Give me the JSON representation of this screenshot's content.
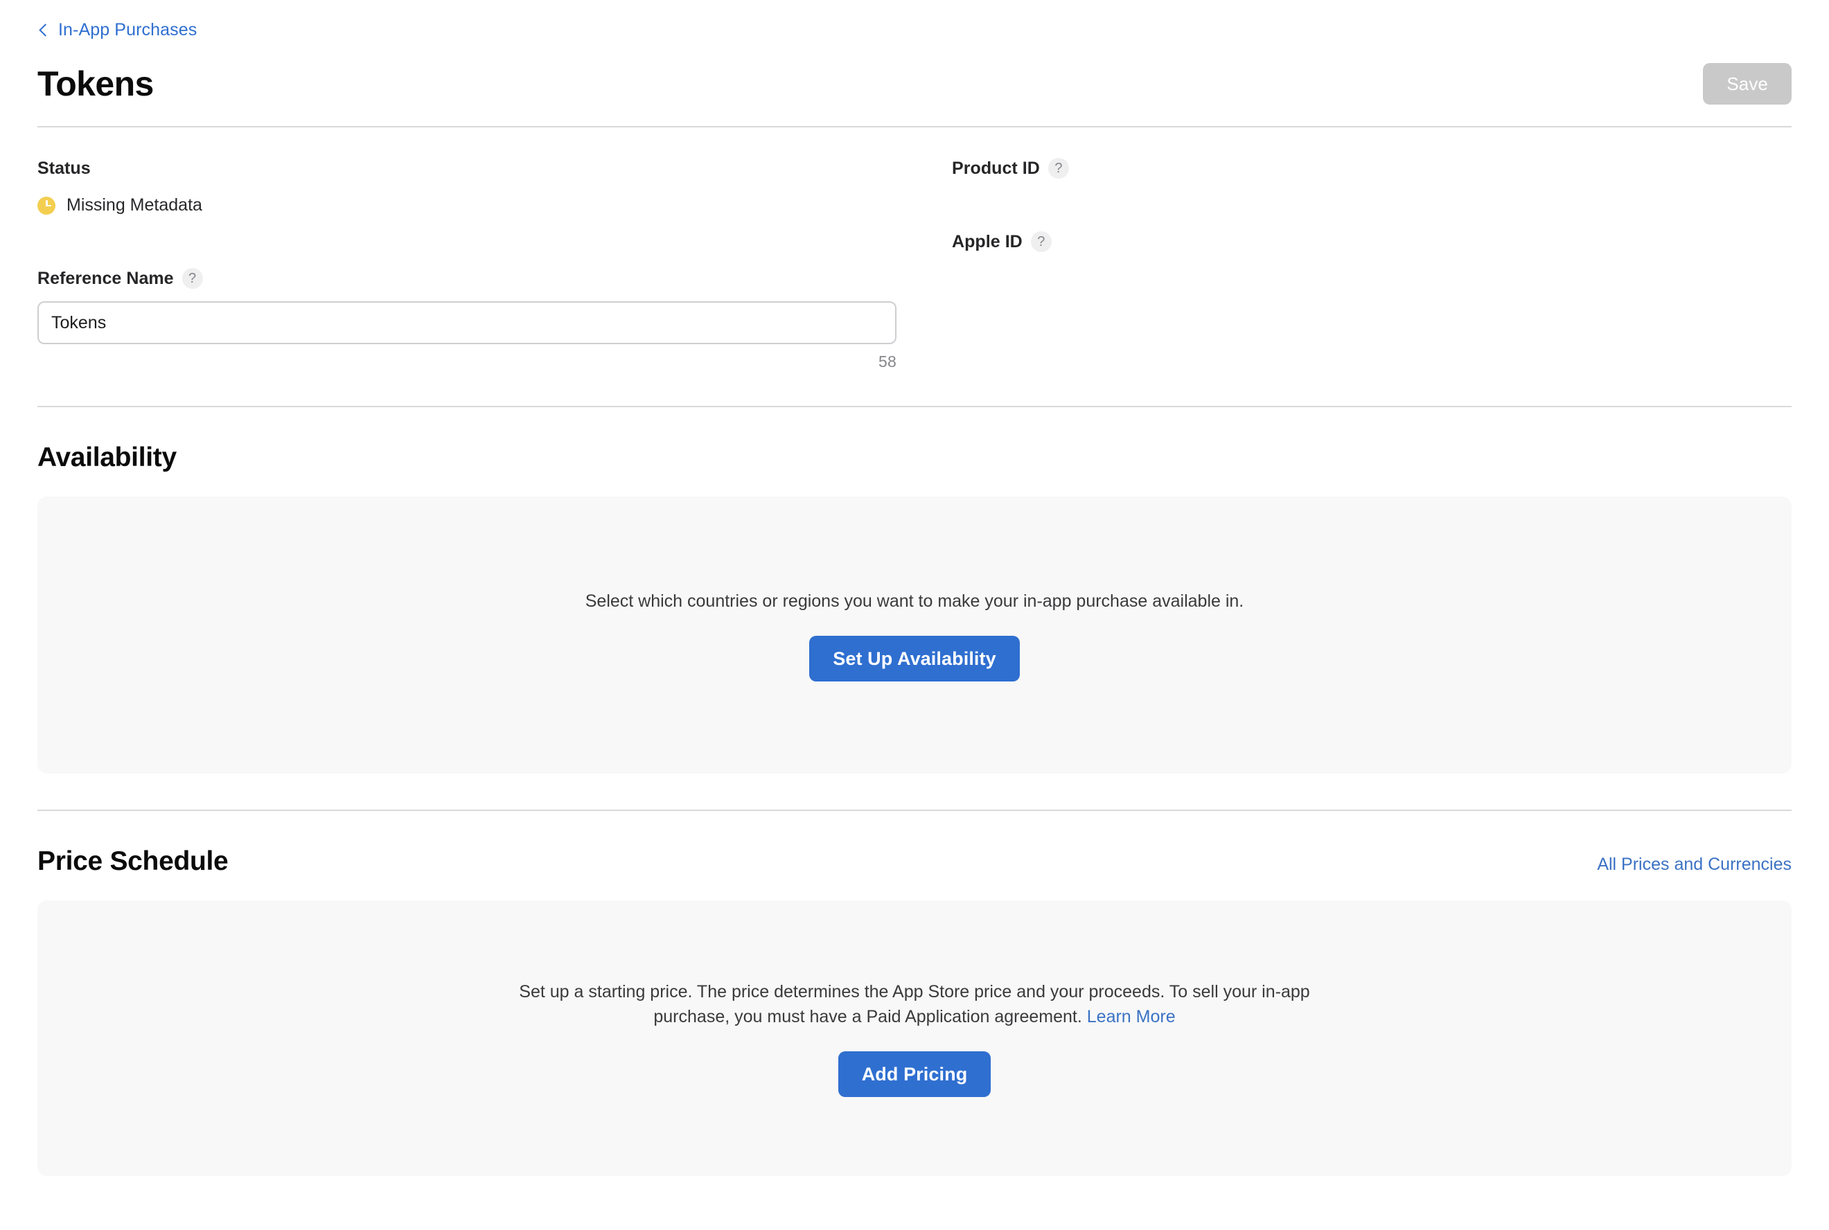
{
  "breadcrumb": {
    "back_icon": "chevron-left-icon",
    "label": "In-App Purchases"
  },
  "header": {
    "title": "Tokens",
    "save_label": "Save",
    "save_disabled": true
  },
  "details": {
    "status": {
      "label": "Status",
      "icon": "clock-icon",
      "icon_color": "#f3ce50",
      "value": "Missing Metadata"
    },
    "reference_name": {
      "label": "Reference Name",
      "help_icon": "question-mark-icon",
      "value": "Tokens",
      "char_count": "58"
    },
    "product_id": {
      "label": "Product ID",
      "help_icon": "question-mark-icon",
      "value": ""
    },
    "apple_id": {
      "label": "Apple ID",
      "help_icon": "question-mark-icon",
      "value": ""
    }
  },
  "availability": {
    "title": "Availability",
    "description": "Select which countries or regions you want to make your in-app purchase available in.",
    "button_label": "Set Up Availability"
  },
  "price_schedule": {
    "title": "Price Schedule",
    "all_prices_link": "All Prices and Currencies",
    "description_part1": "Set up a starting price. The price determines the App Store price and your proceeds. To sell your in-app purchase, you must have a Paid Application agreement. ",
    "learn_more_link": "Learn More",
    "button_label": "Add Pricing"
  },
  "colors": {
    "accent_blue": "#2f6fd0",
    "link_blue": "#3b72c4",
    "status_amber": "#f3ce50",
    "panel_bg": "#f8f8f8",
    "disabled_gray": "#c9c9c9"
  }
}
